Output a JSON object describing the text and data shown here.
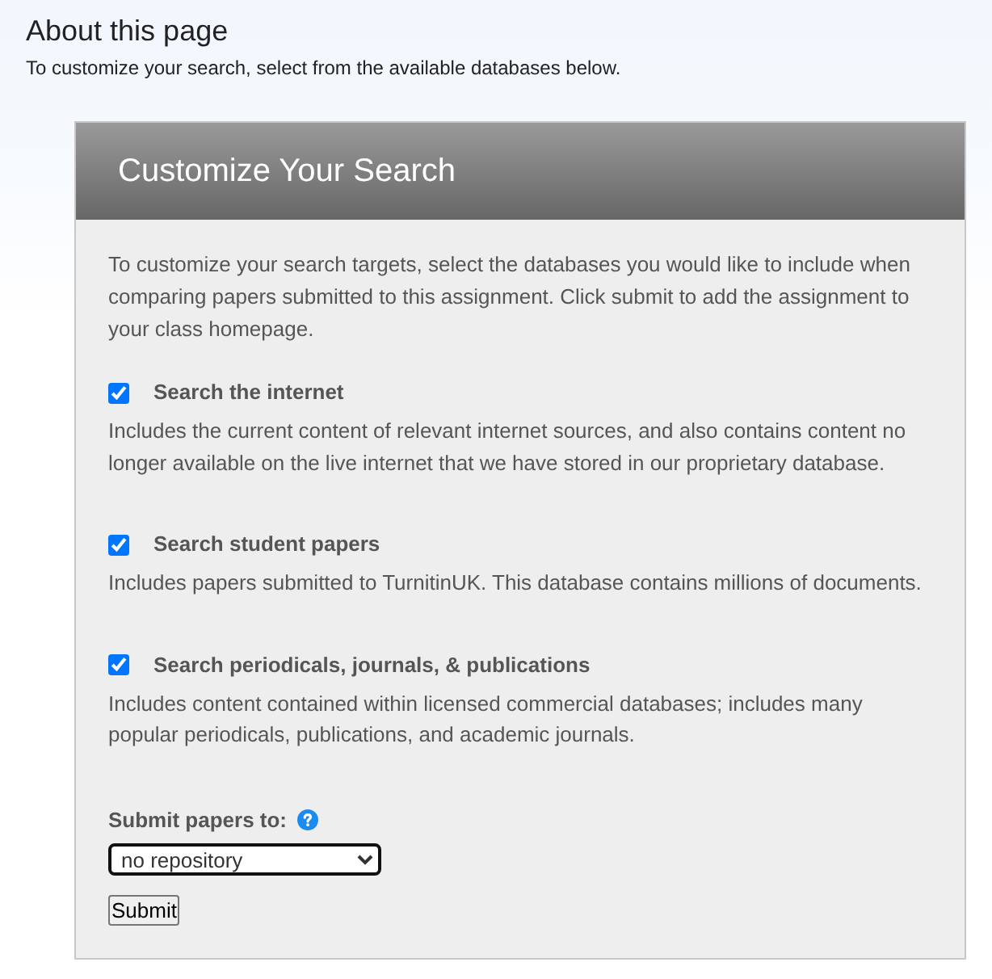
{
  "page": {
    "title": "About this page",
    "subtitle": "To customize your search, select from the available databases below."
  },
  "panel": {
    "title": "Customize Your Search",
    "intro": "To customize your search targets, select the databases you would like to include when comparing papers submitted to this assignment. Click submit to add the assignment to your class homepage.",
    "databases": [
      {
        "label": "Search the internet",
        "checked": true,
        "description": "Includes the current content of relevant internet sources, and also contains content no longer available on the live internet that we have stored in our proprietary database."
      },
      {
        "label": "Search student papers",
        "checked": true,
        "description": "Includes papers submitted to TurnitinUK. This database contains millions of documents."
      },
      {
        "label": "Search periodicals, journals, & publications",
        "checked": true,
        "description": "Includes content contained within licensed commercial databases; includes many popular periodicals, publications, and academic journals."
      }
    ],
    "submit_to": {
      "label": "Submit papers to:",
      "select": {
        "value": "no repository"
      }
    },
    "submit_button": "Submit"
  }
}
